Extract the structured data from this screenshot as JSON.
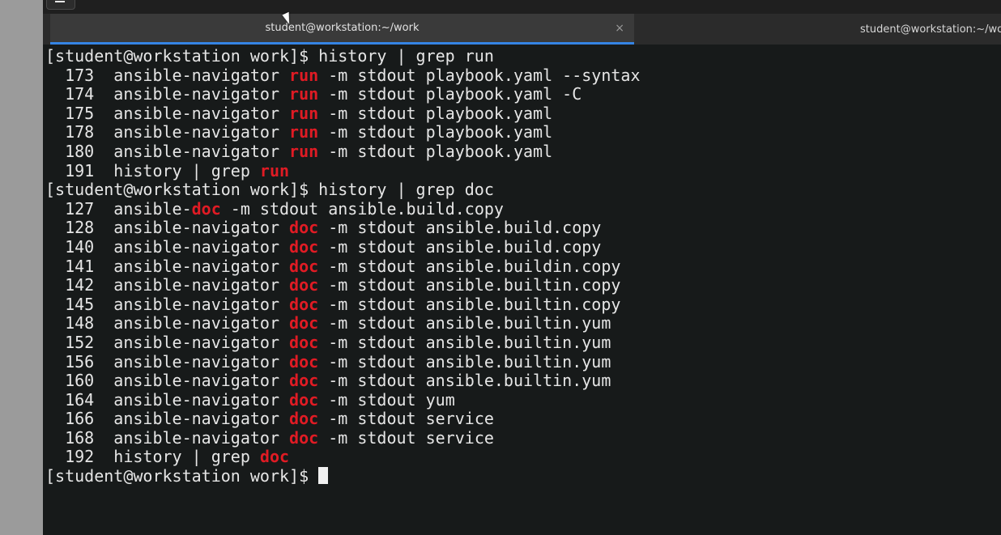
{
  "tabs": [
    {
      "title": "student@workstation:~/work",
      "active": true,
      "close_symbol": "×"
    },
    {
      "title": "student@workstation:~/wor",
      "active": false
    }
  ],
  "terminal": {
    "lines": [
      [
        {
          "t": "[student@workstation work]$ history | grep run"
        }
      ],
      [
        {
          "t": "  173  ansible-navigator "
        },
        {
          "t": "run",
          "h": true
        },
        {
          "t": " -m stdout playbook.yaml --syntax"
        }
      ],
      [
        {
          "t": "  174  ansible-navigator "
        },
        {
          "t": "run",
          "h": true
        },
        {
          "t": " -m stdout playbook.yaml -C"
        }
      ],
      [
        {
          "t": "  175  ansible-navigator "
        },
        {
          "t": "run",
          "h": true
        },
        {
          "t": " -m stdout playbook.yaml"
        }
      ],
      [
        {
          "t": "  178  ansible-navigator "
        },
        {
          "t": "run",
          "h": true
        },
        {
          "t": " -m stdout playbook.yaml"
        }
      ],
      [
        {
          "t": "  180  ansible-navigator "
        },
        {
          "t": "run",
          "h": true
        },
        {
          "t": " -m stdout playbook.yaml"
        }
      ],
      [
        {
          "t": "  191  history | grep "
        },
        {
          "t": "run",
          "h": true
        }
      ],
      [
        {
          "t": "[student@workstation work]$ history | grep doc"
        }
      ],
      [
        {
          "t": "  127  ansible-"
        },
        {
          "t": "doc",
          "h": true
        },
        {
          "t": " -m stdout ansible.build.copy"
        }
      ],
      [
        {
          "t": "  128  ansible-navigator "
        },
        {
          "t": "doc",
          "h": true
        },
        {
          "t": " -m stdout ansible.build.copy"
        }
      ],
      [
        {
          "t": "  140  ansible-navigator "
        },
        {
          "t": "doc",
          "h": true
        },
        {
          "t": " -m stdout ansible.build.copy"
        }
      ],
      [
        {
          "t": "  141  ansible-navigator "
        },
        {
          "t": "doc",
          "h": true
        },
        {
          "t": " -m stdout ansible.buildin.copy"
        }
      ],
      [
        {
          "t": "  142  ansible-navigator "
        },
        {
          "t": "doc",
          "h": true
        },
        {
          "t": " -m stdout ansible.builtin.copy"
        }
      ],
      [
        {
          "t": "  145  ansible-navigator "
        },
        {
          "t": "doc",
          "h": true
        },
        {
          "t": " -m stdout ansible.builtin.copy"
        }
      ],
      [
        {
          "t": "  148  ansible-navigator "
        },
        {
          "t": "doc",
          "h": true
        },
        {
          "t": " -m stdout ansible.builtin.yum"
        }
      ],
      [
        {
          "t": "  152  ansible-navigator "
        },
        {
          "t": "doc",
          "h": true
        },
        {
          "t": " -m stdout ansible.builtin.yum"
        }
      ],
      [
        {
          "t": "  156  ansible-navigator "
        },
        {
          "t": "doc",
          "h": true
        },
        {
          "t": " -m stdout ansible.builtin.yum"
        }
      ],
      [
        {
          "t": "  160  ansible-navigator "
        },
        {
          "t": "doc",
          "h": true
        },
        {
          "t": " -m stdout ansible.builtin.yum"
        }
      ],
      [
        {
          "t": "  164  ansible-navigator "
        },
        {
          "t": "doc",
          "h": true
        },
        {
          "t": " -m stdout yum"
        }
      ],
      [
        {
          "t": "  166  ansible-navigator "
        },
        {
          "t": "doc",
          "h": true
        },
        {
          "t": " -m stdout service"
        }
      ],
      [
        {
          "t": "  168  ansible-navigator "
        },
        {
          "t": "doc",
          "h": true
        },
        {
          "t": " -m stdout service"
        }
      ],
      [
        {
          "t": "  192  history | grep "
        },
        {
          "t": "doc",
          "h": true
        }
      ]
    ],
    "prompt": "[student@workstation work]$ "
  },
  "colors": {
    "background": "#171a1a",
    "foreground": "#e6e6e6",
    "highlight": "#e01b24",
    "tab_accent": "#3584e4"
  },
  "icons": {
    "menu": "hamburger-menu-icon",
    "close": "close-icon",
    "pointer": "mouse-pointer-icon",
    "cursor": "terminal-cursor-icon"
  }
}
